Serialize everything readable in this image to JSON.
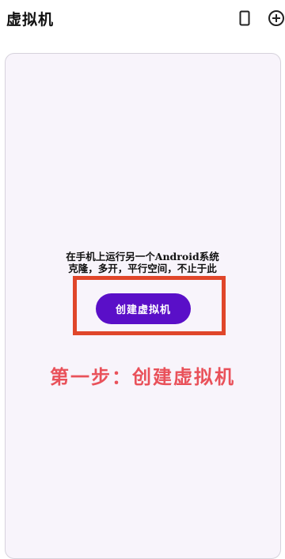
{
  "app": {
    "title": "虚拟机"
  },
  "toolbar": {
    "phone_icon": "phone-icon",
    "add_icon": "add-circle-icon"
  },
  "empty_state": {
    "line1": "在手机上运行另一个Android系统",
    "line2": "克隆，多开，平行空间，不止于此",
    "button_label": "创建虚拟机"
  },
  "annotation": {
    "step_caption": "第一步：创建虚拟机",
    "highlight_color": "#e0462a",
    "caption_color": "#e9515a"
  },
  "colors": {
    "accent": "#5a0fc8",
    "card_background": "#f8f4fb"
  }
}
